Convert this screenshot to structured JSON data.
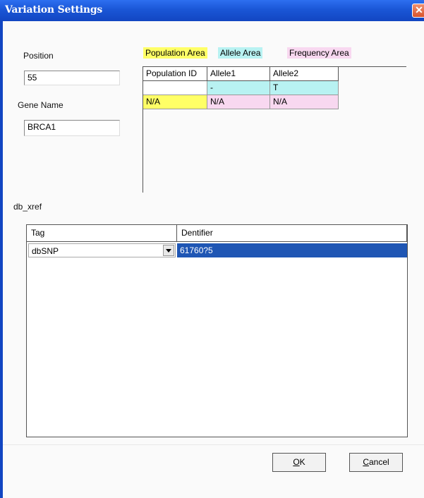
{
  "window": {
    "title": "Variation Settings",
    "close_glyph": "✕"
  },
  "position": {
    "label": "Position",
    "value": "55"
  },
  "gene": {
    "label": "Gene Name",
    "value": "BRCA1"
  },
  "legend": {
    "population": "Population Area",
    "allele": "Allele Area",
    "frequency": "Frequency Area",
    "colors": {
      "population": "#ffff66",
      "allele": "#b8f2f2",
      "frequency": "#f8d8f0"
    }
  },
  "variation_grid": {
    "headers": [
      "Population ID",
      "Allele1",
      "Allele2"
    ],
    "allele_row": [
      "",
      "-",
      "T"
    ],
    "frequency_row": [
      "N/A",
      "N/A",
      "N/A"
    ]
  },
  "db_xref": {
    "label": "db_xref",
    "headers": [
      "Tag",
      "Dentifier"
    ],
    "row": {
      "tag": "dbSNP",
      "identifier": "61760?5"
    },
    "selection_color": "#1f56b4"
  },
  "buttons": {
    "ok_mnemonic": "O",
    "ok_rest": "K",
    "cancel_mnemonic": "C",
    "cancel_rest": "ancel"
  }
}
